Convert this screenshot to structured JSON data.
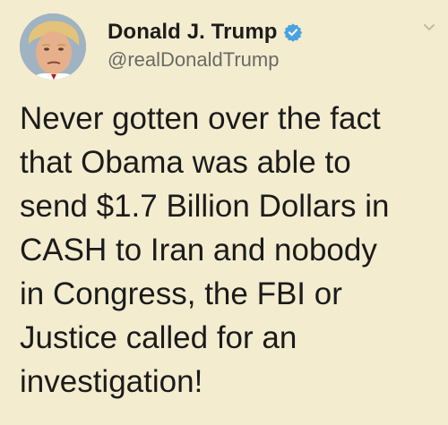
{
  "author": {
    "display_name": "Donald J. Trump",
    "handle": "@realDonaldTrump",
    "verified": true
  },
  "icons": {
    "avatar": "profile-photo",
    "verified": "verified-badge-icon",
    "menu": "chevron-down-icon"
  },
  "tweet": {
    "lines": [
      "Never gotten over the fact",
      "that Obama was able to",
      "send $1.7 Billion Dollars in",
      "CASH to Iran and nobody",
      "in Congress, the FBI or",
      "Justice called for an",
      "investigation!"
    ]
  },
  "colors": {
    "background": "#f3eccf",
    "verified_badge": "#4aa3df",
    "handle_text": "#6a6a66"
  }
}
